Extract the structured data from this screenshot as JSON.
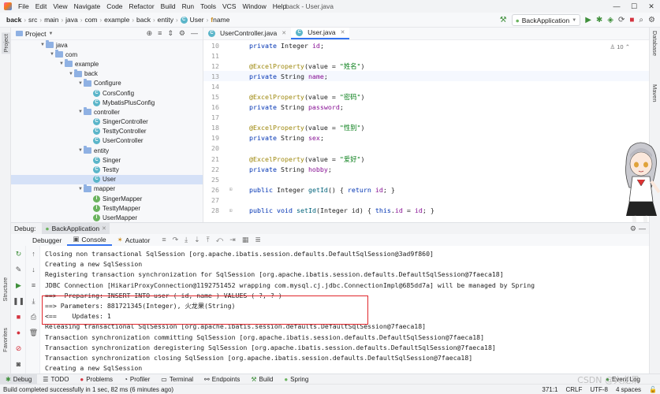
{
  "menubar": {
    "items": [
      "File",
      "Edit",
      "View",
      "Navigate",
      "Code",
      "Refactor",
      "Build",
      "Run",
      "Tools",
      "VCS",
      "Window",
      "Help"
    ],
    "window_title": "back - User.java"
  },
  "navbar": {
    "crumbs": [
      "back",
      "src",
      "main",
      "java",
      "com",
      "example",
      "back",
      "entity",
      "User",
      "name"
    ],
    "run_config": "BackApplication"
  },
  "project": {
    "title": "Project",
    "tree": [
      {
        "label": "java",
        "depth": 0,
        "icon": "folder",
        "expanded": true
      },
      {
        "label": "com",
        "depth": 1,
        "icon": "folder",
        "expanded": true
      },
      {
        "label": "example",
        "depth": 2,
        "icon": "folder",
        "expanded": true
      },
      {
        "label": "back",
        "depth": 3,
        "icon": "folder",
        "expanded": true
      },
      {
        "label": "Configure",
        "depth": 4,
        "icon": "folder",
        "expanded": true
      },
      {
        "label": "CorsConfig",
        "depth": 5,
        "icon": "class"
      },
      {
        "label": "MybatisPlusConfig",
        "depth": 5,
        "icon": "class"
      },
      {
        "label": "controller",
        "depth": 4,
        "icon": "folder",
        "expanded": true
      },
      {
        "label": "SingerController",
        "depth": 5,
        "icon": "class"
      },
      {
        "label": "TesttyController",
        "depth": 5,
        "icon": "class"
      },
      {
        "label": "UserController",
        "depth": 5,
        "icon": "class"
      },
      {
        "label": "entity",
        "depth": 4,
        "icon": "folder",
        "expanded": true
      },
      {
        "label": "Singer",
        "depth": 5,
        "icon": "class"
      },
      {
        "label": "Testty",
        "depth": 5,
        "icon": "class"
      },
      {
        "label": "User",
        "depth": 5,
        "icon": "class",
        "selected": true
      },
      {
        "label": "mapper",
        "depth": 4,
        "icon": "folder",
        "expanded": true
      },
      {
        "label": "SingerMapper",
        "depth": 5,
        "icon": "interface"
      },
      {
        "label": "TesttyMapper",
        "depth": 5,
        "icon": "interface"
      },
      {
        "label": "UserMapper",
        "depth": 5,
        "icon": "interface"
      }
    ]
  },
  "editor": {
    "tabs": [
      {
        "label": "UserController.java",
        "active": false
      },
      {
        "label": "User.java",
        "active": true
      }
    ],
    "usages": "10",
    "lines": [
      {
        "n": "10",
        "html": "private Integer id;"
      },
      {
        "n": "11",
        "html": ""
      },
      {
        "n": "12",
        "html": "@ExcelProperty(value = \"姓名\")"
      },
      {
        "n": "13",
        "html": "private String name;"
      },
      {
        "n": "14",
        "html": ""
      },
      {
        "n": "15",
        "html": "@ExcelProperty(value = \"密码\")"
      },
      {
        "n": "16",
        "html": "private String password;"
      },
      {
        "n": "17",
        "html": ""
      },
      {
        "n": "18",
        "html": "@ExcelProperty(value = \"性别\")"
      },
      {
        "n": "19",
        "html": "private String sex;"
      },
      {
        "n": "20",
        "html": ""
      },
      {
        "n": "21",
        "html": "@ExcelProperty(value = \"爱好\")"
      },
      {
        "n": "22",
        "html": "private String hobby;"
      },
      {
        "n": "25",
        "html": ""
      },
      {
        "n": "26",
        "html": "public Integer getId() { return id; }"
      },
      {
        "n": "27",
        "html": ""
      },
      {
        "n": "28",
        "html": "public void setId(Integer id) { this.id = id; }"
      }
    ]
  },
  "debug": {
    "label": "Debug:",
    "session": "BackApplication",
    "tabs": [
      "Debugger",
      "Console",
      "Actuator"
    ],
    "console_lines": [
      "Closing non transactional SqlSession [org.apache.ibatis.session.defaults.DefaultSqlSession@3ad9f860]",
      "Creating a new SqlSession",
      "Registering transaction synchronization for SqlSession [org.apache.ibatis.session.defaults.DefaultSqlSession@7faeca18]",
      "JDBC Connection [HikariProxyConnection@1192751452 wrapping com.mysql.cj.jdbc.ConnectionImpl@685dd7a] will be managed by Spring",
      "==>  Preparing: INSERT INTO user ( id, name ) VALUES ( ?, ? )",
      "==> Parameters: 881721345(Integer), 火龙果(String)",
      "<==    Updates: 1",
      "Releasing transactional SqlSession [org.apache.ibatis.session.defaults.DefaultSqlSession@7faeca18]",
      "Transaction synchronization committing SqlSession [org.apache.ibatis.session.defaults.DefaultSqlSession@7faeca18]",
      "Transaction synchronization deregistering SqlSession [org.apache.ibatis.session.defaults.DefaultSqlSession@7faeca18]",
      "Transaction synchronization closing SqlSession [org.apache.ibatis.session.defaults.DefaultSqlSession@7faeca18]",
      "Creating a new SqlSession"
    ]
  },
  "bottom_tools": [
    "Debug",
    "TODO",
    "Problems",
    "Profiler",
    "Terminal",
    "Endpoints",
    "Build",
    "Spring"
  ],
  "event_log": "Event Log",
  "status": {
    "message": "Build completed successfully in 1 sec, 82 ms (6 minutes ago)",
    "position": "371:1",
    "line_sep": "CRLF",
    "encoding": "UTF-8",
    "indent": "4 spaces"
  },
  "side_labels": {
    "project": "Project",
    "structure": "Structure",
    "favorites": "Favorites",
    "database": "Database",
    "maven": "Maven"
  },
  "watermark": "CSDN @火龙果"
}
